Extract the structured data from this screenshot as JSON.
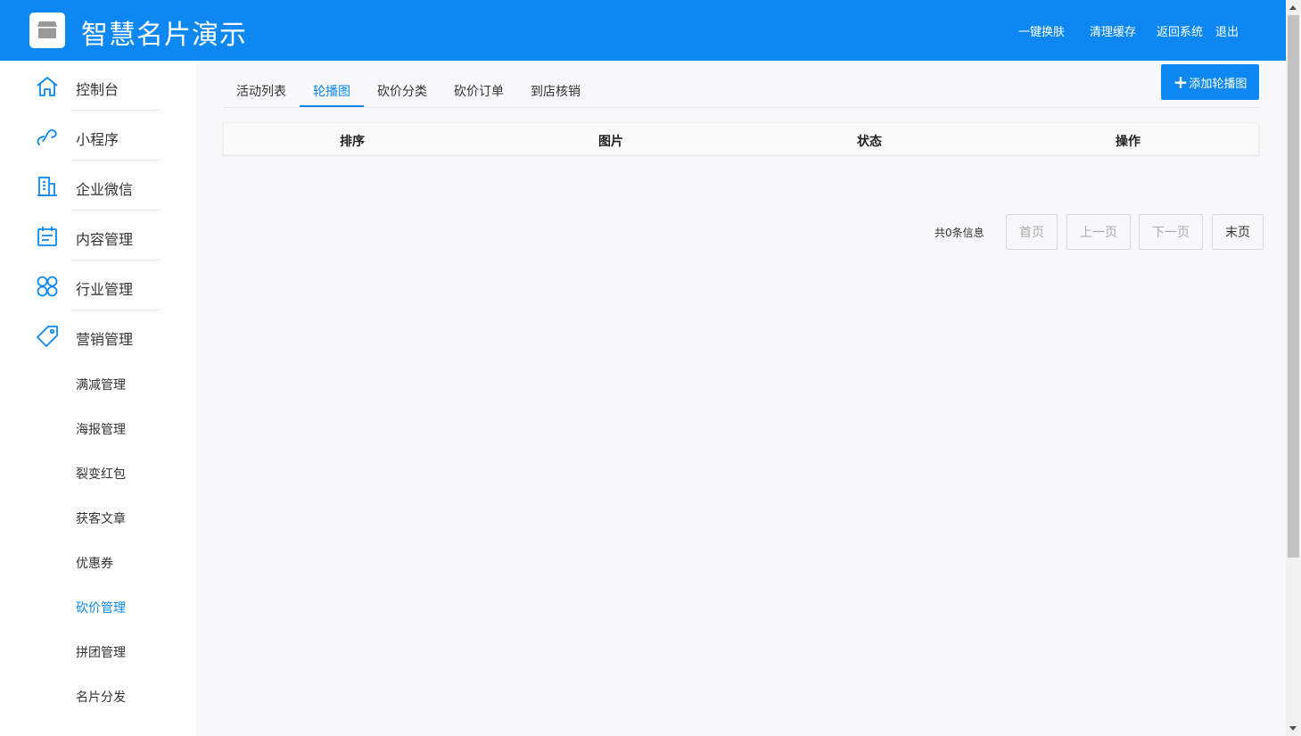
{
  "header": {
    "title": "智慧名片演示",
    "links": [
      "一键换肤",
      "清理缓存",
      "返回系统",
      "退出"
    ],
    "bg_color": "#0d88f2"
  },
  "sidebar": {
    "items": [
      {
        "label": "控制台",
        "icon": "home-icon"
      },
      {
        "label": "小程序",
        "icon": "link-icon"
      },
      {
        "label": "企业微信",
        "icon": "building-icon"
      },
      {
        "label": "内容管理",
        "icon": "calendar-icon"
      },
      {
        "label": "行业管理",
        "icon": "clover-icon"
      },
      {
        "label": "营销管理",
        "icon": "tag-icon"
      }
    ],
    "sub_items": [
      "满减管理",
      "海报管理",
      "裂变红包",
      "获客文章",
      "优惠券",
      "砍价管理",
      "拼团管理",
      "名片分发"
    ],
    "active_sub": "砍价管理"
  },
  "tabs": [
    "活动列表",
    "轮播图",
    "砍价分类",
    "砍价订单",
    "到店核销"
  ],
  "active_tab": "轮播图",
  "add_button": {
    "label": "添加轮播图",
    "icon": "plus-icon"
  },
  "table": {
    "columns": [
      "排序",
      "图片",
      "状态",
      "操作"
    ],
    "rows": []
  },
  "pagination": {
    "total_text": "共0条信息",
    "buttons": [
      "首页",
      "上一页",
      "下一页",
      "末页"
    ]
  },
  "accent_color": "#0d88f2"
}
